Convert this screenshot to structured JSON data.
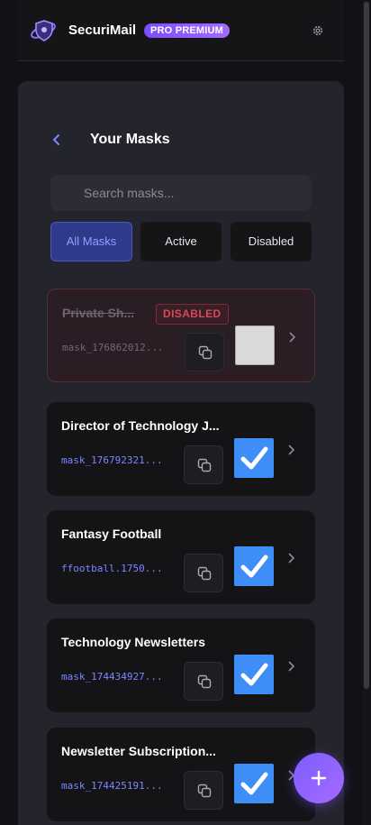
{
  "app": {
    "brand": "SecuriMail",
    "badge": "PRO PREMIUM"
  },
  "page": {
    "title": "Your Masks"
  },
  "search": {
    "placeholder": "Search masks..."
  },
  "filters": [
    {
      "label": "All Masks",
      "active": true
    },
    {
      "label": "Active",
      "active": false
    },
    {
      "label": "Disabled",
      "active": false
    }
  ],
  "masks": [
    {
      "name": "Private Sh...",
      "id": "mask_176862012...",
      "status": "DISABLED",
      "enabled": false
    },
    {
      "name": "Director of Technology J...",
      "id": "mask_176792321...",
      "enabled": true
    },
    {
      "name": "Fantasy Football",
      "id": "ffootball.1750...",
      "enabled": true
    },
    {
      "name": "Technology Newsletters",
      "id": "mask_174434927...",
      "enabled": true
    },
    {
      "name": "Newsletter Subscription...",
      "id": "mask_174425191...",
      "enabled": true
    }
  ],
  "colors": {
    "accent": "#7c5cff",
    "check": "#3e8ef7",
    "link": "#7b86ff",
    "danger": "#d14b5b"
  },
  "icons": [
    "logo-icon",
    "gear-icon",
    "back-icon",
    "search-icon",
    "copy-icon",
    "check-icon",
    "chevron-right-icon",
    "plus-icon"
  ]
}
